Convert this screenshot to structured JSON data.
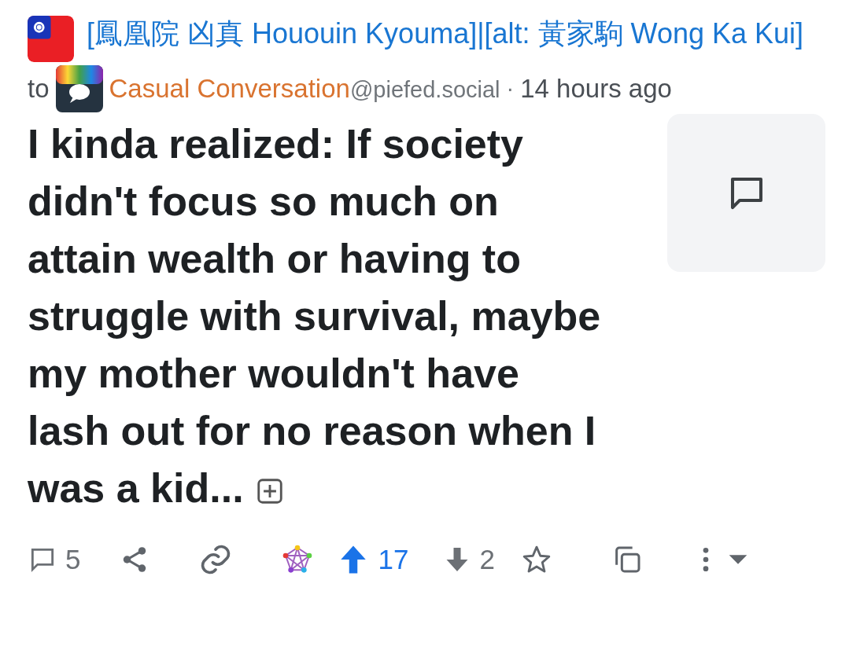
{
  "author": {
    "name": "[鳳凰院 凶真 Hououin Kyouma]|[alt: 黃家駒 Wong Ka Kui]"
  },
  "community": {
    "prefix": "to",
    "name": "Casual Conversation",
    "instance": "@piefed.social",
    "separator": "·",
    "time": "14 hours ago"
  },
  "post": {
    "title": "I kinda realized: If society didn't focus so much on attain wealth or having to struggle with survival, maybe my mother wouldn't have lash out for no reason when I was a kid...",
    "has_thumbnail": true
  },
  "actions": {
    "comments": "5",
    "upvotes": "17",
    "downvotes": "2",
    "upvoted": true
  }
}
